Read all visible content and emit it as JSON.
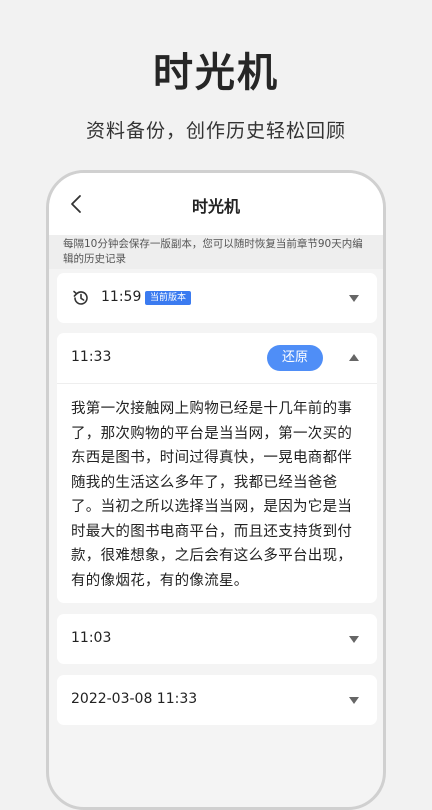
{
  "promo": {
    "title": "时光机",
    "subtitle": "资料备份，创作历史轻松回顾"
  },
  "nav": {
    "back_icon": "chevron-left-icon",
    "title": "时光机"
  },
  "hint": "每隔10分钟会保存一版副本，您可以随时恢复当前章节90天内编辑的历史记录",
  "versions": [
    {
      "time": "11:59",
      "badge": "当前版本",
      "icon": "history-icon",
      "expanded": false
    },
    {
      "time": "11:33",
      "action": "还原",
      "expanded": true,
      "content": "我第一次接触网上购物已经是十几年前的事了，那次购物的平台是当当网，第一次买的东西是图书，时间过得真快，一晃电商都伴随我的生活这么多年了，我都已经当爸爸了。当初之所以选择当当网，是因为它是当时最大的图书电商平台，而且还支持货到付款，很难想象，之后会有这么多平台出现，有的像烟花，有的像流星。"
    },
    {
      "time": "11:03",
      "expanded": false
    },
    {
      "time": "2022-03-08 11:33",
      "expanded": false
    }
  ],
  "colors": {
    "accent": "#4f8ef7",
    "badge": "#3b7bf0",
    "background": "#f4f4f4"
  }
}
